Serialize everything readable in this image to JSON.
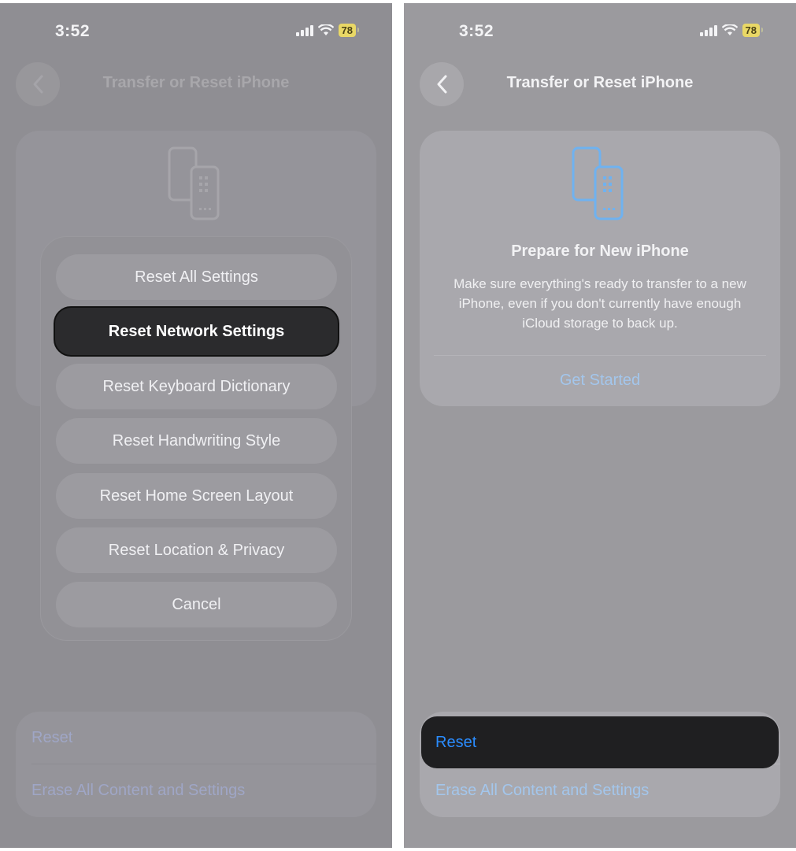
{
  "left": {
    "status": {
      "time": "3:52",
      "battery": "78"
    },
    "nav": {
      "title": "Transfer or Reset iPhone"
    },
    "action_sheet": {
      "items": [
        "Reset All Settings",
        "Reset Network Settings",
        "Reset Keyboard Dictionary",
        "Reset Handwriting Style",
        "Reset Home Screen Layout",
        "Reset Location & Privacy",
        "Cancel"
      ],
      "highlighted": "Reset Network Settings"
    },
    "bottom": {
      "reset_label": "Reset",
      "erase_label": "Erase All Content and Settings"
    }
  },
  "right": {
    "status": {
      "time": "3:52",
      "battery": "78"
    },
    "nav": {
      "title": "Transfer or Reset iPhone"
    },
    "hero": {
      "title": "Prepare for New iPhone",
      "description": "Make sure everything's ready to transfer to a new iPhone, even if you don't currently have enough iCloud storage to back up.",
      "cta": "Get Started"
    },
    "bottom": {
      "reset_label": "Reset",
      "erase_label": "Erase All Content and Settings"
    }
  },
  "colors": {
    "accent_blue": "#2a8cff",
    "highlight_dark": "#1f1f21",
    "battery_yellow": "#e9d866",
    "phone_icon_blue": "#6fb2f0"
  },
  "icons": [
    "signal-icon",
    "wifi-icon",
    "battery-icon",
    "chevron-left-icon",
    "phones-transfer-icon"
  ]
}
